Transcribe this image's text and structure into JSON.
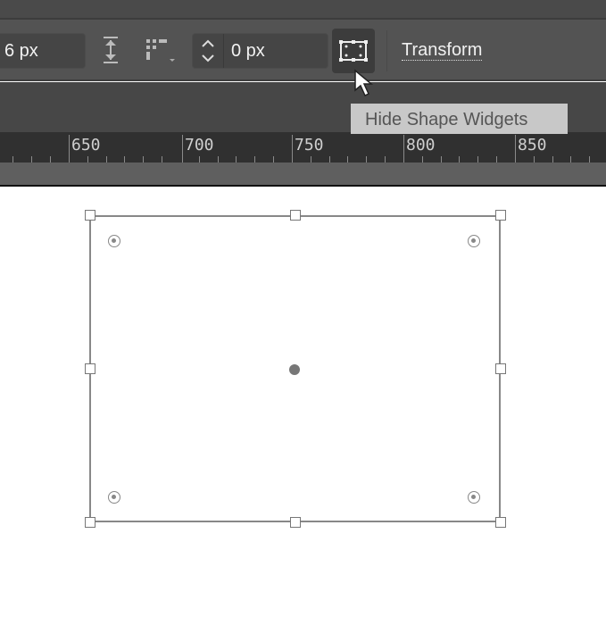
{
  "toolbar": {
    "width_value": "6 px",
    "radius_value": "0 px",
    "transform_label": "Transform"
  },
  "tooltip": "Hide Shape Widgets",
  "ruler": {
    "labels": [
      "650",
      "700",
      "750",
      "800",
      "850"
    ]
  }
}
